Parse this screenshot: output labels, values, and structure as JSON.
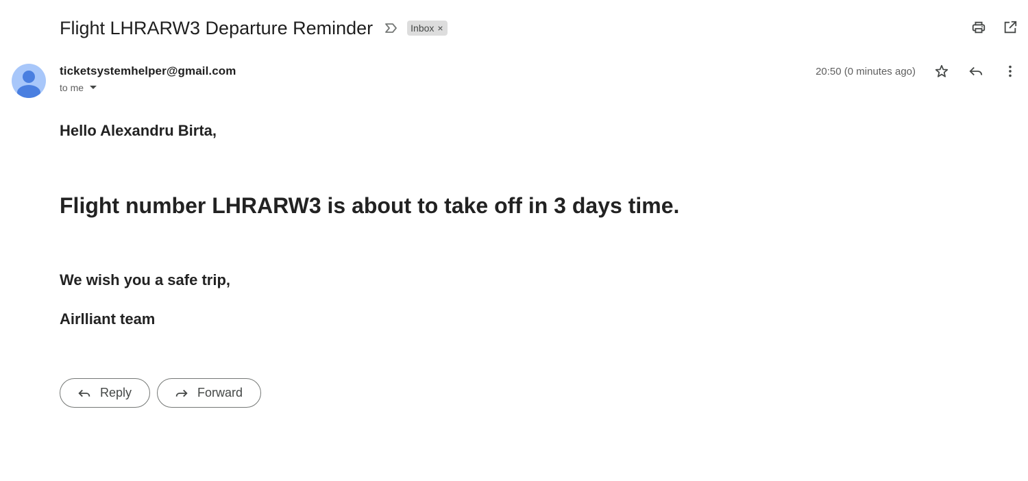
{
  "email": {
    "subject": "Flight LHRARW3 Departure Reminder",
    "label": "Inbox",
    "label_close": "×",
    "sender": "ticketsystemhelper@gmail.com",
    "to_text": "to me",
    "timestamp": "20:50 (0 minutes ago)"
  },
  "body": {
    "greeting": "Hello Alexandru Birta,",
    "headline": "Flight number LHRARW3 is about to take off in 3 days time.",
    "wish": "We wish you a safe trip,",
    "signature": "Airlliant team"
  },
  "actions": {
    "reply_label": "Reply",
    "forward_label": "Forward"
  },
  "icons": {
    "important": "important-marker-icon",
    "print": "print-icon",
    "open_new_window": "open-in-new-window-icon",
    "star": "star-icon",
    "reply": "reply-icon",
    "more": "more-vertical-icon",
    "forward": "forward-icon",
    "caret": "caret-down-icon"
  },
  "colors": {
    "avatar_bg": "#a8c7fa",
    "avatar_fg": "#4a7fe0",
    "chip_bg": "#dddddd"
  }
}
